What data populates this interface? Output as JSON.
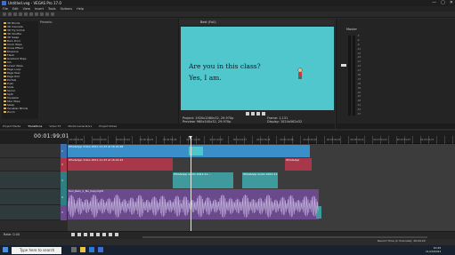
{
  "window": {
    "title": "Untitled.veg - VEGAS Pro 17.0",
    "controls": [
      "—",
      "▢",
      "✕"
    ]
  },
  "menu": [
    "File",
    "Edit",
    "View",
    "Insert",
    "Tools",
    "Options",
    "Help"
  ],
  "explorer": {
    "presets_label": "Presets:",
    "tree": [
      "3D Blinds",
      "3D Cascade",
      "3D Fly In/Out",
      "3D Shuttle",
      "3D Swap",
      "Barn Door",
      "Clock Wipe",
      "Cross Effect",
      "Dissolve",
      "Flash",
      "Gradient Wipe",
      "Iris",
      "Linear Wipe",
      "Page Loop",
      "Page Peel",
      "Page Roll",
      "Portals",
      "Push",
      "Slide",
      "Spiral",
      "Split",
      "Squeeze",
      "Star Wipe",
      "Swap",
      "Venetian Blinds",
      "Zoom"
    ],
    "tabs": [
      "Project Media",
      "Transitions",
      "Video FX",
      "Media Generators",
      "Project Notes"
    ]
  },
  "preview": {
    "quality": "Best (Full)",
    "caption_question": "Are you in this class?",
    "caption_answer": "Yes, I am.",
    "info_left": "Project: 1920x1080x32, 29.970p\nPreview: 960x540x32, 29.970p",
    "info_right": "Frame: 1,131\nDisplay: 1024x562x32",
    "tab": "Video Preview"
  },
  "master": {
    "label": "Master",
    "db_marks": [
      "-3",
      "-6",
      "-9",
      "-12",
      "-15",
      "-18",
      "-21",
      "-24",
      "-27",
      "-30",
      "-33",
      "-36",
      "-39",
      "-42",
      "-45",
      "-48",
      "-51",
      "-54",
      "-57"
    ],
    "tab": "Master Bus"
  },
  "timeline": {
    "timecode": "00:01:99;01",
    "ruler_labels": [
      "00:00:00;00",
      "00:00:15;00",
      "00:00:29;29",
      "00:00:44;29",
      "00:00:59;28",
      "00:01:14;28",
      "00:01:29;27",
      "00:01:44;27",
      "00:01:59;26",
      "00:02:14;26",
      "00:02:29;25",
      "00:02:44;25",
      "00:02:59;24",
      "00:03:14;24",
      "00:03:29;23",
      "00:03:44;23"
    ],
    "track_numbers": [
      "1",
      "2",
      "3",
      "4",
      "5"
    ],
    "clips": {
      "whatsapp_video_1": "WhatsApp Video 2021-11-23 at 16.22.48",
      "whatsapp_video_2": "WhatsApp Video 2021-11-23 at 16.24.22",
      "whatsapp_video_3": "WhatsApp",
      "whatsapp_audio_1": "WhatsApp Audio 2021-11-...",
      "whatsapp_audio_2": "WhatsApp Audio 2021-11-23 at...",
      "music": "Sun_Rain_1_No_Copyright"
    },
    "colors": {
      "video_blue": "#3a8fc9",
      "video_red": "#a8374a",
      "audio_teal": "#3f9a9d",
      "music_purple": "#6a4a8c"
    }
  },
  "bottom": {
    "rate": "Rate: 0.00",
    "status": "Record Time (2 channels): 26:09:20"
  },
  "taskbar": {
    "search_placeholder": "Type here to search",
    "time": "10:45",
    "date": "11/23/2021"
  }
}
